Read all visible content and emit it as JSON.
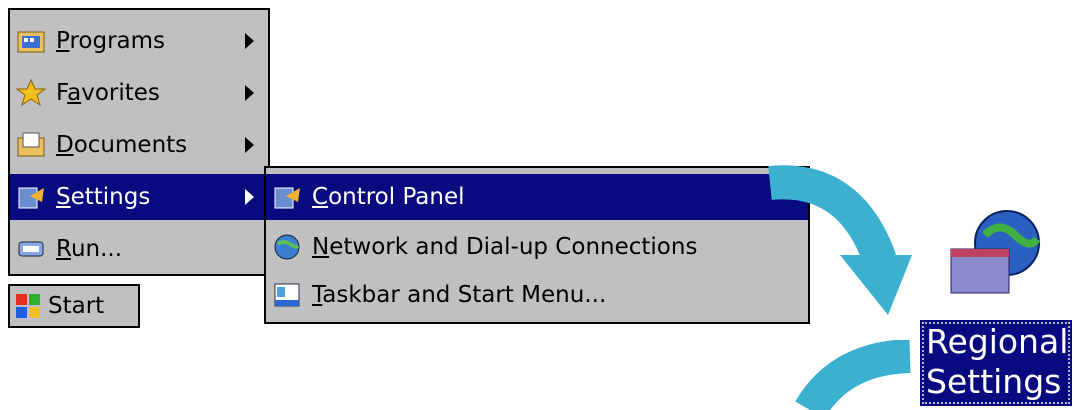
{
  "start_menu": {
    "items": [
      {
        "label_pre": "",
        "label_u": "P",
        "label_post": "rograms",
        "has_submenu": true
      },
      {
        "label_pre": "F",
        "label_u": "a",
        "label_post": "vorites",
        "has_submenu": true
      },
      {
        "label_pre": "",
        "label_u": "D",
        "label_post": "ocuments",
        "has_submenu": true
      },
      {
        "label_pre": "",
        "label_u": "S",
        "label_post": "ettings",
        "has_submenu": true
      },
      {
        "label_pre": "",
        "label_u": "R",
        "label_post": "un...",
        "has_submenu": false
      }
    ]
  },
  "settings_submenu": {
    "items": [
      {
        "label_pre": "",
        "label_u": "C",
        "label_post": "ontrol Panel"
      },
      {
        "label_pre": "",
        "label_u": "N",
        "label_post": "etwork and Dial-up Connections"
      },
      {
        "label_pre": "",
        "label_u": "T",
        "label_post": "askbar and Start Menu..."
      }
    ]
  },
  "taskbar": {
    "start_label": "Start"
  },
  "regional_settings": {
    "line1": "Regional",
    "line2": "Settings"
  },
  "colors": {
    "menu_bg": "#c0c0c0",
    "highlight": "#0a0a80",
    "arrow": "#3bb0d0"
  }
}
